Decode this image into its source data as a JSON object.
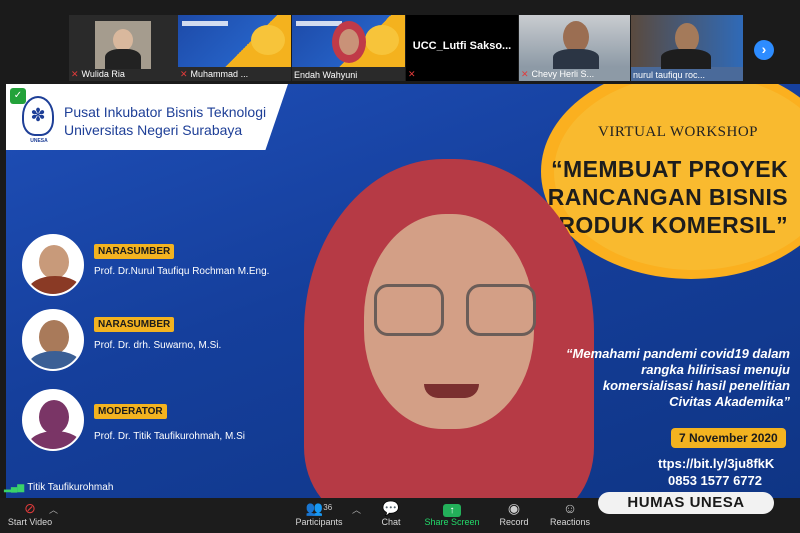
{
  "gallery": {
    "participants": [
      {
        "name": "Wulida Ria",
        "muted": true
      },
      {
        "name": "Muhammad ...",
        "muted": true
      },
      {
        "name": "Endah Wahyuni",
        "muted": false
      },
      {
        "name": "UCC_Lutfi  Sakso...",
        "muted": true
      },
      {
        "name": "Chevy Herli S...",
        "muted": true
      },
      {
        "name": "nurul taufiqu roc...",
        "muted": false
      }
    ],
    "next_icon": "›"
  },
  "slide": {
    "org_line1": "Pusat Inkubator Bisnis Teknologi",
    "org_line2": "Universitas Negeri Surabaya",
    "emblem_label": "UNESA",
    "event_type": "VIRTUAL WORKSHOP",
    "title_line1": "“MEMBUAT PROYEK",
    "title_line2": "RANCANGAN BISNIS",
    "title_line3": "PRODUK KOMERSIL”",
    "speakers": [
      {
        "role": "NARASUMBER",
        "name": "Prof. Dr.Nurul Taufiqu Rochman M.Eng."
      },
      {
        "role": "NARASUMBER",
        "name": "Prof. Dr. drh. Suwarno, M.Si."
      },
      {
        "role": "MODERATOR",
        "name": "Prof. Dr. Titik Taufikurohmah, M.Si"
      }
    ],
    "quote": "“Memahami pandemi covid19 dalam rangka hilirisasi menuju komersialisasi hasil penelitian Civitas Akademika”",
    "date": "7 November 2020",
    "link": "ttps://bit.ly/3ju8fkK",
    "phone": "0853 1577 6772"
  },
  "active_speaker": "Titik Taufikurohmah",
  "toolbar": {
    "start_video": "Start Video",
    "participants": "Participants",
    "participants_count": "36",
    "chat": "Chat",
    "share_screen": "Share Screen",
    "record": "Record",
    "reactions": "Reactions"
  },
  "watermark": "HUMAS UNESA",
  "colors": {
    "accent_blue": "#2d8cff",
    "share_green": "#23b05a",
    "slide_yellow": "#f3b320",
    "slide_blue": "#1f4fb8"
  }
}
